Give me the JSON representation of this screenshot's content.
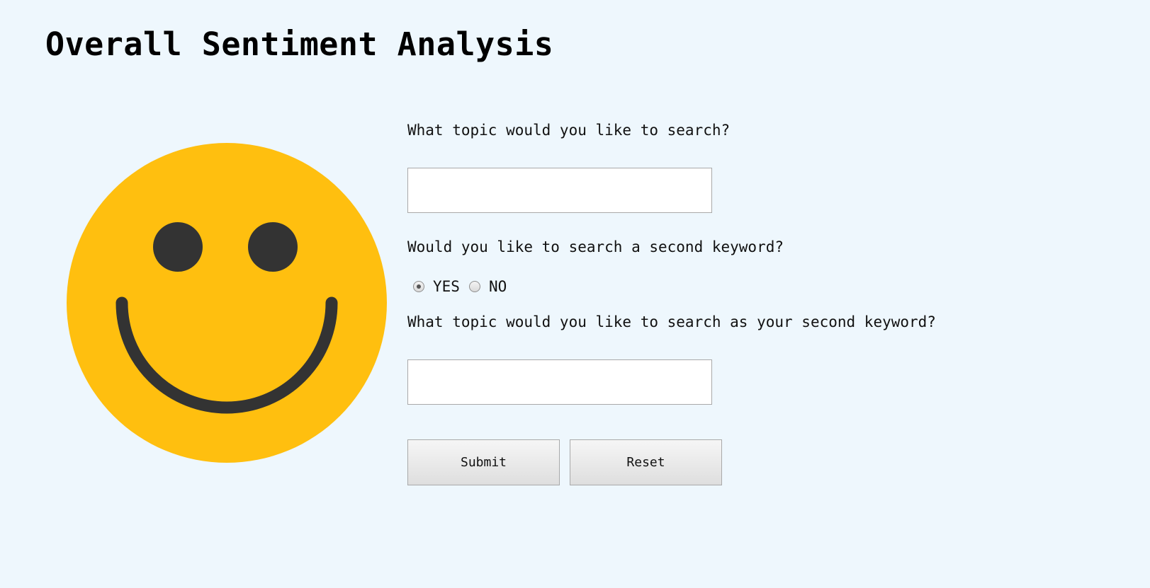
{
  "page": {
    "title": "Overall Sentiment Analysis"
  },
  "smiley": {
    "icon": "smiley-face-icon",
    "face_color": "#FFBF0F",
    "feature_color": "#333333"
  },
  "form": {
    "q1_label": "What topic would you like to search?",
    "q1_value": "",
    "q2_label": "Would you like to search a second keyword?",
    "yes_label": "YES",
    "no_label": "NO",
    "selected": "YES",
    "q3_label": "What topic would you like to search as your second keyword?",
    "q3_value": "",
    "submit_label": "Submit",
    "reset_label": "Reset"
  },
  "colors": {
    "background": "#EEF7FD"
  }
}
